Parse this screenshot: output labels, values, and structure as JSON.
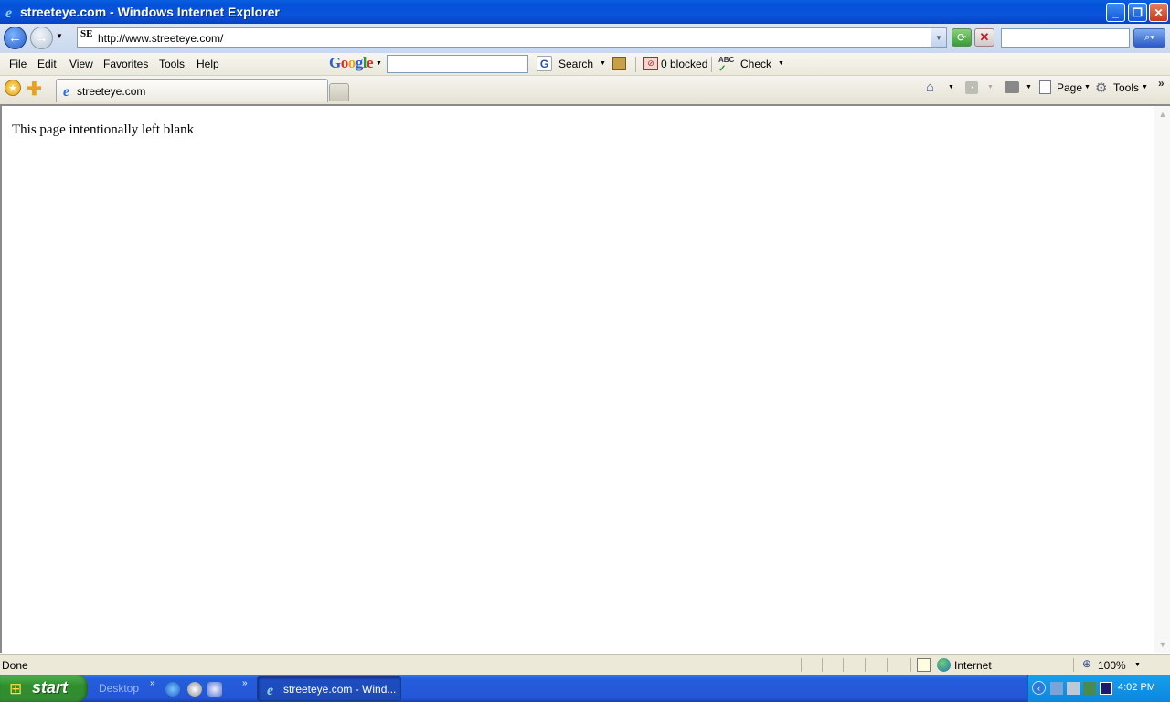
{
  "window": {
    "title": "streeteye.com - Windows Internet Explorer"
  },
  "address": {
    "url": "http://www.streeteye.com/",
    "favicon_text": "SE"
  },
  "menu": {
    "items": [
      "File",
      "Edit",
      "View",
      "Favorites",
      "Tools",
      "Help"
    ]
  },
  "google_toolbar": {
    "logo": "Google",
    "search_label": "Search",
    "blocked_label": "0 blocked",
    "check_label": "Check",
    "abc": "ABC"
  },
  "tab": {
    "label": "streeteye.com"
  },
  "command_bar": {
    "page_label": "Page",
    "tools_label": "Tools"
  },
  "content": {
    "text": "This page intentionally left blank"
  },
  "status": {
    "text": "Done",
    "zone": "Internet",
    "zoom": "100%"
  },
  "taskbar": {
    "start_label": "start",
    "desktop_label": "Desktop",
    "task_label": "streeteye.com - Wind...",
    "clock": "4:02 PM"
  },
  "colors": {
    "titlebar": "#0a54dc",
    "taskbar": "#245edb",
    "start": "#338a33"
  },
  "icons": [
    "ie-icon",
    "back-arrow-icon",
    "forward-arrow-icon",
    "refresh-icon",
    "stop-icon",
    "search-go-icon",
    "google-search-icon",
    "popup-blocked-icon",
    "spellcheck-icon",
    "favorites-star-icon",
    "add-favorite-icon",
    "home-icon",
    "feeds-icon",
    "print-icon",
    "page-icon",
    "tools-gear-icon",
    "globe-icon",
    "zoom-icon",
    "windows-flag-icon"
  ]
}
